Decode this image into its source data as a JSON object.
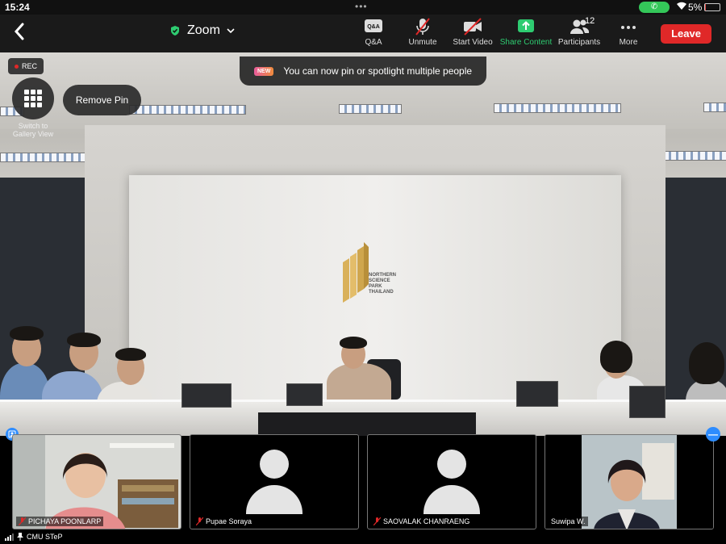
{
  "status_bar": {
    "time": "15:24",
    "battery_percent": "5%",
    "battery_level": 0.05,
    "call_active": true
  },
  "toolbar": {
    "meeting_name": "Zoom",
    "buttons": [
      {
        "id": "qa",
        "label": "Q&A",
        "icon": "qa-icon",
        "icon_text": "Q&A"
      },
      {
        "id": "unmute",
        "label": "Unmute",
        "icon": "mic-muted-icon"
      },
      {
        "id": "video",
        "label": "Start Video",
        "icon": "video-off-icon"
      },
      {
        "id": "share",
        "label": "Share Content",
        "icon": "share-screen-icon"
      },
      {
        "id": "participants",
        "label": "Participants",
        "icon": "participants-icon",
        "count": "12"
      },
      {
        "id": "more",
        "label": "More",
        "icon": "more-icon"
      }
    ],
    "leave_label": "Leave"
  },
  "overlays": {
    "rec_label": "REC",
    "toast_badge": "NEW",
    "toast_text": "You can now pin or spotlight multiple people",
    "gallery_label": "Switch to Gallery View",
    "remove_pin_label": "Remove Pin"
  },
  "thumbnails": [
    {
      "name": "PICHAYA POONLARP",
      "muted": true,
      "video": true
    },
    {
      "name": "Pupae Soraya",
      "muted": true,
      "video": false
    },
    {
      "name": "SAOVALAK CHANRAENG",
      "muted": true,
      "video": false
    },
    {
      "name": "Suwipa W.",
      "muted": false,
      "video": true
    }
  ],
  "footer": {
    "pinned_label": "CMU STeP"
  },
  "colors": {
    "leave": "#e02828",
    "share": "#2ecc71",
    "accent": "#2d8cff"
  }
}
